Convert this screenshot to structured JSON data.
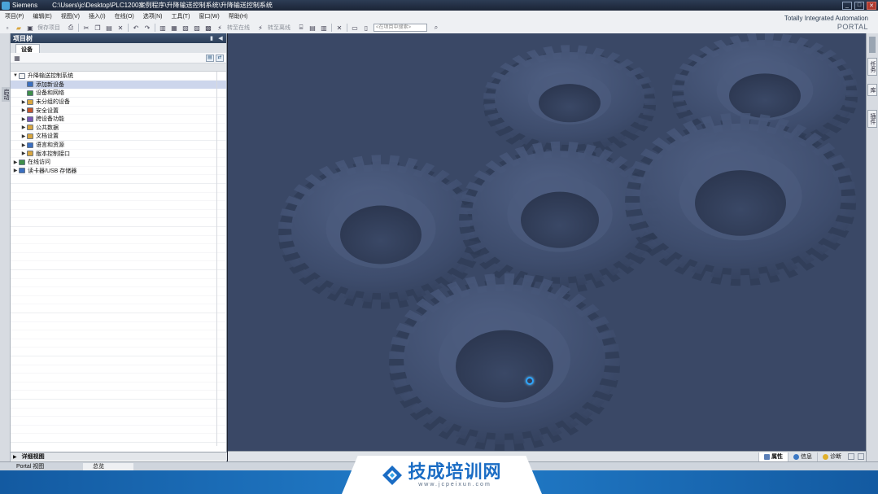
{
  "window": {
    "app_name": "Siemens",
    "path": "C:\\Users\\jc\\Desktop\\PLC1200案例程序\\升降输送控制系统\\升降输送控制系统",
    "controls": [
      "_",
      "□",
      "✕"
    ]
  },
  "menu": [
    "项目(P)",
    "编辑(E)",
    "视图(V)",
    "插入(I)",
    "在线(O)",
    "选项(N)",
    "工具(T)",
    "窗口(W)",
    "帮助(H)"
  ],
  "brand": {
    "line1": "Totally Integrated Automation",
    "line2": "PORTAL"
  },
  "toolbar": {
    "save_project": "保存项目",
    "go_online": "转至在线",
    "go_offline": "转至离线",
    "search_placeholder": "<在项目中搜索>"
  },
  "left_strip": {
    "label": "启动"
  },
  "project_tree": {
    "title": "项目树",
    "tab": "设备",
    "items": [
      {
        "label": "升降输送控制系统",
        "level": 0,
        "expanded": true,
        "icon_color": "#f4f4f4",
        "selected": false
      },
      {
        "label": "添加新设备",
        "level": 1,
        "expanded": null,
        "icon_color": "#3b6fc0",
        "selected": true
      },
      {
        "label": "设备和网络",
        "level": 1,
        "expanded": null,
        "icon_color": "#3f8f4a",
        "selected": false
      },
      {
        "label": "未分组的设备",
        "level": 1,
        "expanded": false,
        "icon_color": "#d9a640",
        "selected": false
      },
      {
        "label": "安全设置",
        "level": 1,
        "expanded": false,
        "icon_color": "#c3562c",
        "selected": false
      },
      {
        "label": "跨设备功能",
        "level": 1,
        "expanded": false,
        "icon_color": "#7a56b5",
        "selected": false
      },
      {
        "label": "公共数据",
        "level": 1,
        "expanded": false,
        "icon_color": "#d9a640",
        "selected": false
      },
      {
        "label": "文档设置",
        "level": 1,
        "expanded": false,
        "icon_color": "#d9a640",
        "selected": false
      },
      {
        "label": "语言和资源",
        "level": 1,
        "expanded": false,
        "icon_color": "#3b6fc0",
        "selected": false
      },
      {
        "label": "版本控制接口",
        "level": 1,
        "expanded": false,
        "icon_color": "#d9a640",
        "selected": false
      },
      {
        "label": "在线访问",
        "level": 0,
        "expanded": false,
        "icon_color": "#3f8f4a",
        "selected": false
      },
      {
        "label": "读卡器/USB 存储器",
        "level": 0,
        "expanded": false,
        "icon_color": "#3b6fc0",
        "selected": false
      }
    ]
  },
  "detail_view": {
    "label": "详细视图"
  },
  "right_strip": {
    "tabs": [
      "任务",
      "库",
      "插件"
    ]
  },
  "inspector": {
    "properties": "属性",
    "info": "信息",
    "diagnostics": "诊断"
  },
  "bottom": {
    "portal_view": "Portal 视图",
    "overview": "总览"
  },
  "watermark": {
    "title": "技成培训网",
    "url": "www.jcpeixun.com"
  },
  "colors": {
    "workspace": "#3a4866",
    "accent": "#1a6cc4",
    "panel_header": "#3f5573"
  }
}
